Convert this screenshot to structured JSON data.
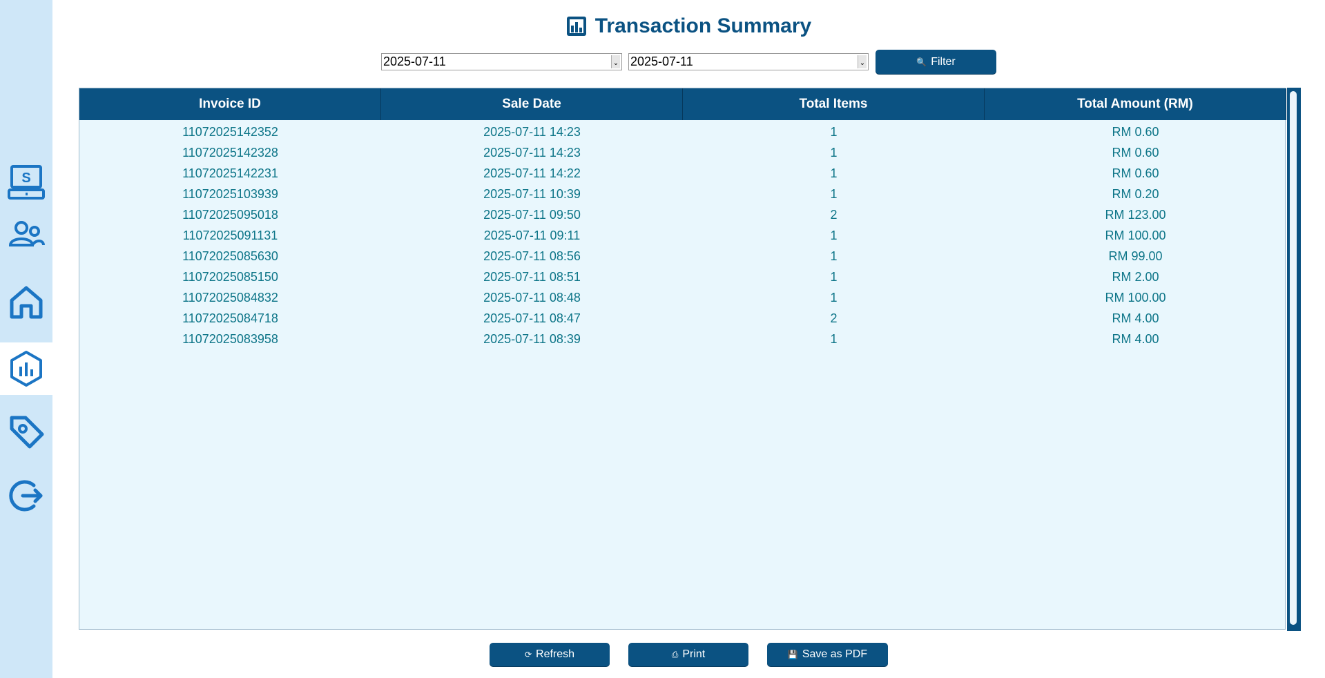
{
  "sidebar": {
    "items": [
      {
        "name": "cashier-icon"
      },
      {
        "name": "users-icon"
      },
      {
        "name": "home-icon"
      },
      {
        "name": "report-icon",
        "active": true
      },
      {
        "name": "tag-icon"
      },
      {
        "name": "logout-icon"
      }
    ],
    "bg_color": "#cfe7f8",
    "icon_color": "#1b75c4"
  },
  "header": {
    "title": "Transaction Summary",
    "icon": "chart-icon"
  },
  "filter": {
    "start_date": "2025-07-11",
    "end_date": "2025-07-11",
    "button_label": "Filter",
    "button_icon": "magnifier-icon"
  },
  "table": {
    "columns": [
      "Invoice ID",
      "Sale Date",
      "Total Items",
      "Total Amount (RM)"
    ],
    "rows": [
      [
        "11072025142352",
        "2025-07-11 14:23",
        "1",
        "RM 0.60"
      ],
      [
        "11072025142328",
        "2025-07-11 14:23",
        "1",
        "RM 0.60"
      ],
      [
        "11072025142231",
        "2025-07-11 14:22",
        "1",
        "RM 0.60"
      ],
      [
        "11072025103939",
        "2025-07-11 10:39",
        "1",
        "RM 0.20"
      ],
      [
        "11072025095018",
        "2025-07-11 09:50",
        "2",
        "RM 123.00"
      ],
      [
        "11072025091131",
        "2025-07-11 09:11",
        "1",
        "RM 100.00"
      ],
      [
        "11072025085630",
        "2025-07-11 08:56",
        "1",
        "RM 99.00"
      ],
      [
        "11072025085150",
        "2025-07-11 08:51",
        "1",
        "RM 2.00"
      ],
      [
        "11072025084832",
        "2025-07-11 08:48",
        "1",
        "RM 100.00"
      ],
      [
        "11072025084718",
        "2025-07-11 08:47",
        "2",
        "RM 4.00"
      ],
      [
        "11072025083958",
        "2025-07-11 08:39",
        "1",
        "RM 4.00"
      ]
    ],
    "header_color": "#0b5282",
    "body_color": "#e9f7fd",
    "text_color": "#0d7588"
  },
  "footer": {
    "refresh_label": "Refresh",
    "print_label": "Print",
    "pdf_label": "Save as PDF"
  },
  "colors": {
    "accent": "#0b5282"
  }
}
